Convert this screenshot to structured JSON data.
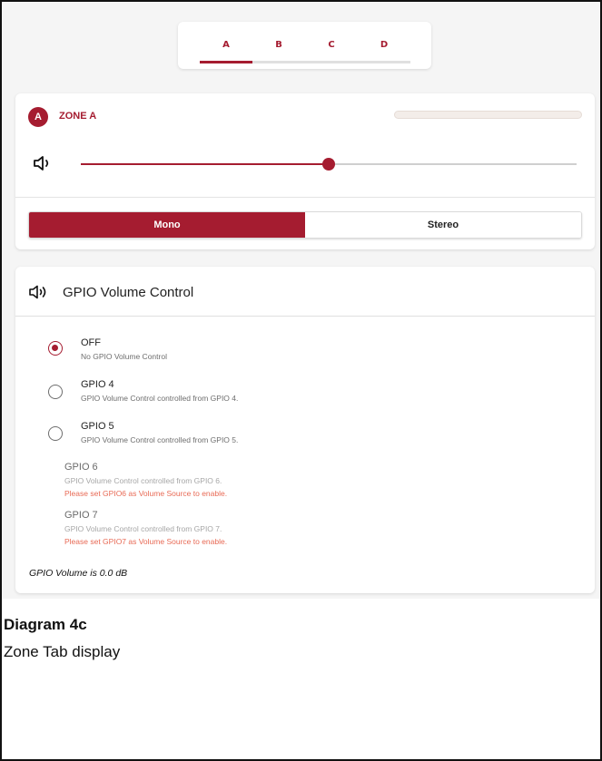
{
  "tabs": {
    "items": [
      {
        "label": "A",
        "active": true
      },
      {
        "label": "B",
        "active": false
      },
      {
        "label": "C",
        "active": false
      },
      {
        "label": "D",
        "active": false
      }
    ]
  },
  "zone": {
    "avatar_letter": "A",
    "title": "ZONE A",
    "volume_percent": 50,
    "modes": {
      "mono": "Mono",
      "stereo": "Stereo"
    },
    "selected_mode": "Mono"
  },
  "gpio": {
    "title": "GPIO Volume Control",
    "options": [
      {
        "label": "OFF",
        "desc": "No GPIO Volume Control",
        "checked": true,
        "enabled": true
      },
      {
        "label": "GPIO 4",
        "desc": "GPIO Volume Control controlled from GPIO 4.",
        "checked": false,
        "enabled": true
      },
      {
        "label": "GPIO 5",
        "desc": "GPIO Volume Control controlled from GPIO 5.",
        "checked": false,
        "enabled": true
      },
      {
        "label": "GPIO 6",
        "desc": "GPIO Volume Control controlled from GPIO 6.",
        "warning": "Please set GPIO6 as Volume Source to enable.",
        "enabled": false
      },
      {
        "label": "GPIO 7",
        "desc": "GPIO Volume Control controlled from GPIO 7.",
        "warning": "Please set GPIO7 as Volume Source to enable.",
        "enabled": false
      }
    ],
    "status": "GPIO Volume is 0.0 dB"
  },
  "caption": {
    "title": "Diagram 4c",
    "subtitle": "Zone Tab display"
  },
  "colors": {
    "accent": "#a51c30",
    "warning": "#e86a55"
  },
  "icons": {
    "volume": "volume-low-icon",
    "gpio": "volume-high-icon"
  }
}
